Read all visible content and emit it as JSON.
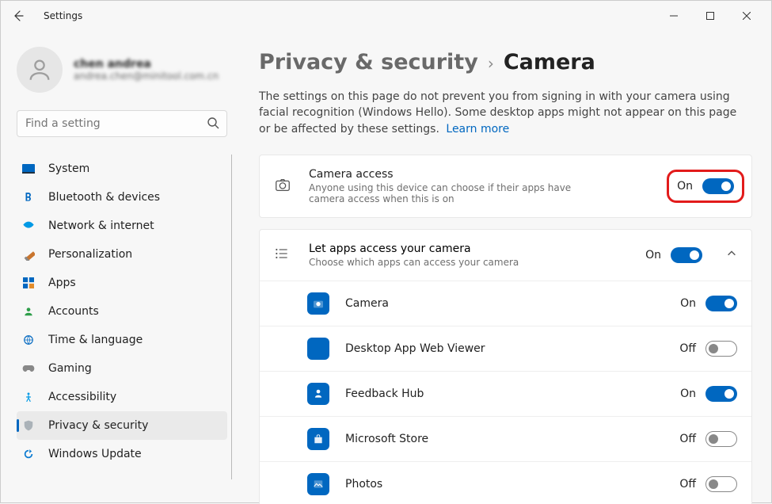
{
  "window": {
    "title": "Settings"
  },
  "user": {
    "name": "chen andrea",
    "email": "andrea.chen@minitool.com.cn"
  },
  "search": {
    "placeholder": "Find a setting"
  },
  "sidebar": {
    "items": [
      {
        "label": "System"
      },
      {
        "label": "Bluetooth & devices"
      },
      {
        "label": "Network & internet"
      },
      {
        "label": "Personalization"
      },
      {
        "label": "Apps"
      },
      {
        "label": "Accounts"
      },
      {
        "label": "Time & language"
      },
      {
        "label": "Gaming"
      },
      {
        "label": "Accessibility"
      },
      {
        "label": "Privacy & security"
      },
      {
        "label": "Windows Update"
      }
    ],
    "selectedIndex": 9
  },
  "breadcrumb": {
    "parent": "Privacy & security",
    "current": "Camera"
  },
  "description": "The settings on this page do not prevent you from signing in with your camera using facial recognition (Windows Hello). Some desktop apps might not appear on this page or be affected by these settings.",
  "learnMore": "Learn more",
  "cameraAccess": {
    "title": "Camera access",
    "subtitle": "Anyone using this device can choose if their apps have camera access when this is on",
    "state": "On",
    "on": true
  },
  "appsAccess": {
    "title": "Let apps access your camera",
    "subtitle": "Choose which apps can access your camera",
    "state": "On",
    "on": true,
    "expanded": true
  },
  "apps": [
    {
      "name": "Camera",
      "state": "On",
      "on": true,
      "color": "#0067c0"
    },
    {
      "name": "Desktop App Web Viewer",
      "state": "Off",
      "on": false,
      "color": "#0067c0"
    },
    {
      "name": "Feedback Hub",
      "state": "On",
      "on": true,
      "color": "#0067c0"
    },
    {
      "name": "Microsoft Store",
      "state": "Off",
      "on": false,
      "color": "#0067c0"
    },
    {
      "name": "Photos",
      "state": "Off",
      "on": false,
      "color": "#0067c0"
    }
  ]
}
